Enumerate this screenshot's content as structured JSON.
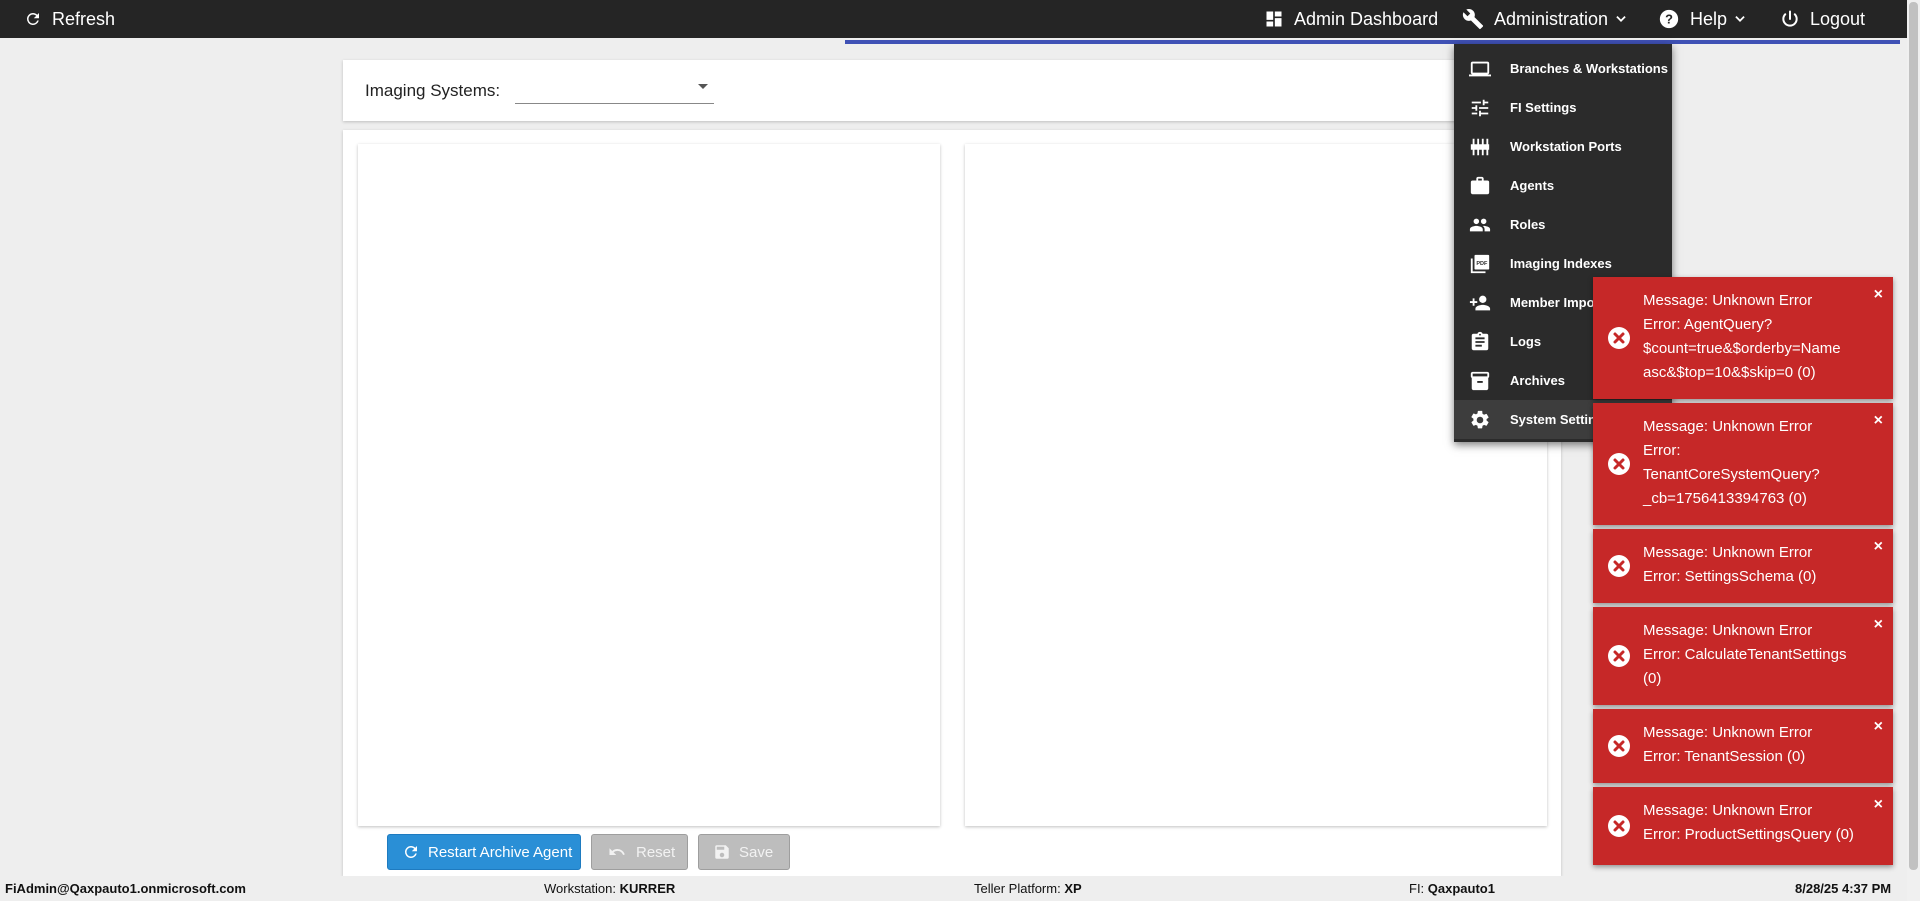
{
  "topbar": {
    "refresh": "Refresh",
    "admin_dashboard": "Admin Dashboard",
    "administration": "Administration",
    "help": "Help",
    "logout": "Logout"
  },
  "header": {
    "imaging_label": "Imaging Systems:",
    "imaging_value": ""
  },
  "buttons": {
    "restart": "Restart Archive Agent",
    "reset": "Reset",
    "save": "Save"
  },
  "menu": {
    "items": [
      {
        "label": "Branches & Workstations",
        "icon": "laptop-icon"
      },
      {
        "label": "FI Settings",
        "icon": "tune-icon"
      },
      {
        "label": "Workstation Ports",
        "icon": "ports-icon"
      },
      {
        "label": "Agents",
        "icon": "briefcase-icon"
      },
      {
        "label": "Roles",
        "icon": "people-icon"
      },
      {
        "label": "Imaging Indexes",
        "icon": "pdf-icon"
      },
      {
        "label": "Member Import",
        "icon": "person-add-icon"
      },
      {
        "label": "Logs",
        "icon": "clipboard-icon"
      },
      {
        "label": "Archives",
        "icon": "archive-icon"
      },
      {
        "label": "System Settings",
        "icon": "gear-icon"
      }
    ]
  },
  "toasts": [
    {
      "text": "Message: Unknown Error\nError: AgentQuery?\n$count=true&$orderby=Name\nasc&$top=10&$skip=0 (0)"
    },
    {
      "text": "Message: Unknown Error\nError:\nTenantCoreSystemQuery?\n_cb=1756413394763 (0)"
    },
    {
      "text": "Message: Unknown Error\nError: SettingsSchema (0)"
    },
    {
      "text": "Message: Unknown Error\nError: CalculateTenantSettings\n(0)"
    },
    {
      "text": "Message: Unknown Error\nError: TenantSession (0)"
    },
    {
      "text": "Message: Unknown Error\nError: ProductSettingsQuery (0)"
    }
  ],
  "toast_close": "×",
  "status": {
    "user": "FiAdmin@Qaxpauto1.onmicrosoft.com",
    "workstation_label": "Workstation:",
    "workstation_value": "KURRER",
    "teller_label": "Teller Platform:",
    "teller_value": "XP",
    "fi_label": "FI:",
    "fi_value": "Qaxpauto1",
    "datetime": "8/28/25 4:37 PM"
  },
  "colors": {
    "topbar": "#252525",
    "accent": "#3f51b5",
    "primary_button": "#2a8fd6",
    "toast_error": "#c62828"
  }
}
